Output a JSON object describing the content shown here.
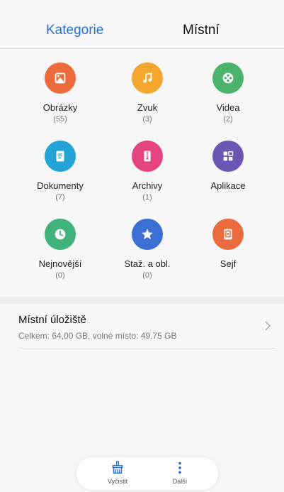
{
  "tabs": {
    "categories": "Kategorie",
    "local": "Místní"
  },
  "categories": [
    {
      "label": "Obrázky",
      "count": "(55)",
      "color": "#ec6b3c"
    },
    {
      "label": "Zvuk",
      "count": "(3)",
      "color": "#f3a52e"
    },
    {
      "label": "Videa",
      "count": "(2)",
      "color": "#4cb36d"
    },
    {
      "label": "Dokumenty",
      "count": "(7)",
      "color": "#22a5d4"
    },
    {
      "label": "Archivy",
      "count": "(1)",
      "color": "#e3447f"
    },
    {
      "label": "Aplikace",
      "count": "",
      "color": "#6b56b3"
    },
    {
      "label": "Nejnovější",
      "count": "(0)",
      "color": "#41b27b"
    },
    {
      "label": "Staž. a obl.",
      "count": "(0)",
      "color": "#3b6fd3"
    },
    {
      "label": "Sejf",
      "count": "",
      "color": "#ea6b3e"
    }
  ],
  "storage": {
    "title": "Místní úložiště",
    "subtitle": "Celkem: 64,00 GB, volné místo: 49,75 GB"
  },
  "bottom": {
    "clean_label": "Vyčistit",
    "more_label": "Další"
  }
}
